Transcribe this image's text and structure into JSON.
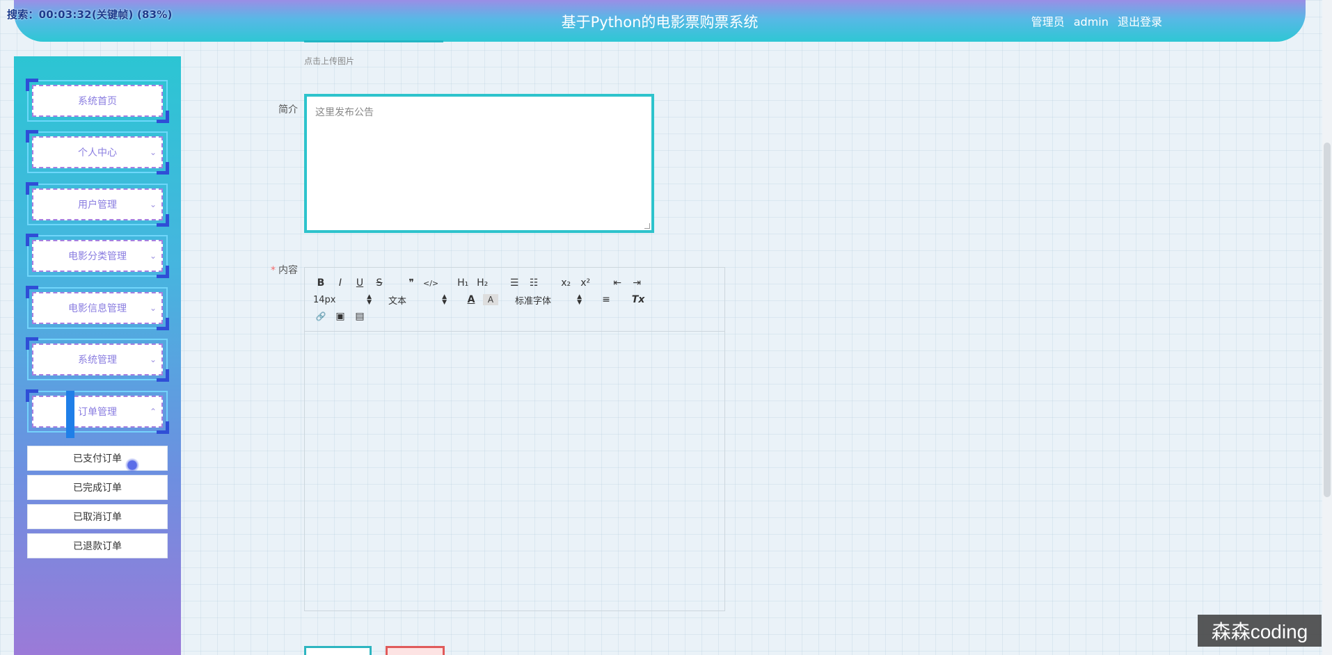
{
  "recording": "搜索：00:03:32(关键帧) (83%)",
  "app_title": "基于Python的电影票购票系统",
  "user": {
    "role": "管理员",
    "name": "admin",
    "logout": "退出登录"
  },
  "sidebar": {
    "items": [
      {
        "label": "系统首页",
        "has_chevron": false
      },
      {
        "label": "个人中心",
        "chevron": "⌄"
      },
      {
        "label": "用户管理",
        "chevron": "⌄"
      },
      {
        "label": "电影分类管理",
        "chevron": "⌄"
      },
      {
        "label": "电影信息管理",
        "chevron": "⌄"
      },
      {
        "label": "系统管理",
        "chevron": "⌄"
      },
      {
        "label": "订单管理",
        "chevron": "⌃"
      }
    ],
    "submenu": [
      "已支付订单",
      "已完成订单",
      "已取消订单",
      "已退款订单"
    ]
  },
  "form": {
    "upload_hint": "点击上传图片",
    "intro_label": "简介",
    "intro_placeholder": "这里发布公告",
    "content_required": "*",
    "content_label": "内容"
  },
  "editor": {
    "row1": [
      "B",
      "I",
      "U",
      "S",
      "❞",
      "</>",
      "H₁",
      "H₂",
      "☰",
      "☷",
      "x₂",
      "x²",
      "⇤",
      "⇥"
    ],
    "font_size": "14px",
    "block_type": "文本",
    "font_family": "标准字体",
    "text_color_icon": "A",
    "bg_color_icon": "A",
    "align_icon": "≡",
    "clear_format_icon": "Tx",
    "row3": [
      "🔗",
      "▣",
      "▤"
    ]
  },
  "watermark": "森森coding",
  "colors": {
    "accent": "#2dc3cc",
    "nav_corner": "#2f4ed6",
    "menu_text": "#8a7de0",
    "required": "#f56c6c"
  }
}
